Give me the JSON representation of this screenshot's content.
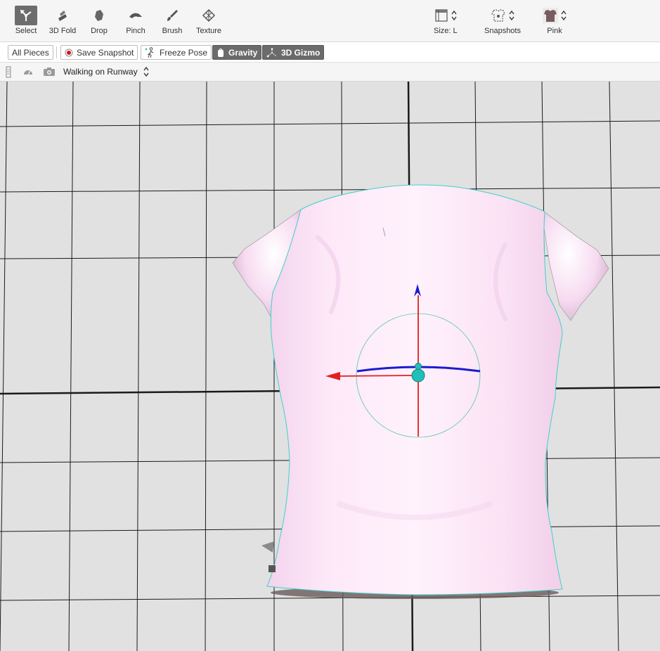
{
  "toolbar": {
    "tools": [
      {
        "label": "Select",
        "icon": "select-icon",
        "active": true
      },
      {
        "label": "3D Fold",
        "icon": "fold-icon",
        "active": false
      },
      {
        "label": "Drop",
        "icon": "drop-icon",
        "active": false
      },
      {
        "label": "Pinch",
        "icon": "pinch-icon",
        "active": false
      },
      {
        "label": "Brush",
        "icon": "brush-icon",
        "active": false
      },
      {
        "label": "Texture",
        "icon": "texture-icon",
        "active": false
      }
    ],
    "size_label": "Size: L",
    "snapshots_label": "Snapshots",
    "color_label": "Pink"
  },
  "actionbar": {
    "all_pieces": "All Pieces",
    "save_snapshot": "Save Snapshot",
    "freeze_pose": "Freeze Pose",
    "gravity": "Gravity",
    "gizmo": "3D Gizmo"
  },
  "animbar": {
    "animation": "Walking on Runway"
  },
  "colors": {
    "garment": "#fbe4f7",
    "background": "#e1e1e1",
    "outline": "#3fd1c9",
    "axis_x": "#e02020",
    "axis_z": "#1a1ad0",
    "gizmo_center": "#20c0b8"
  }
}
